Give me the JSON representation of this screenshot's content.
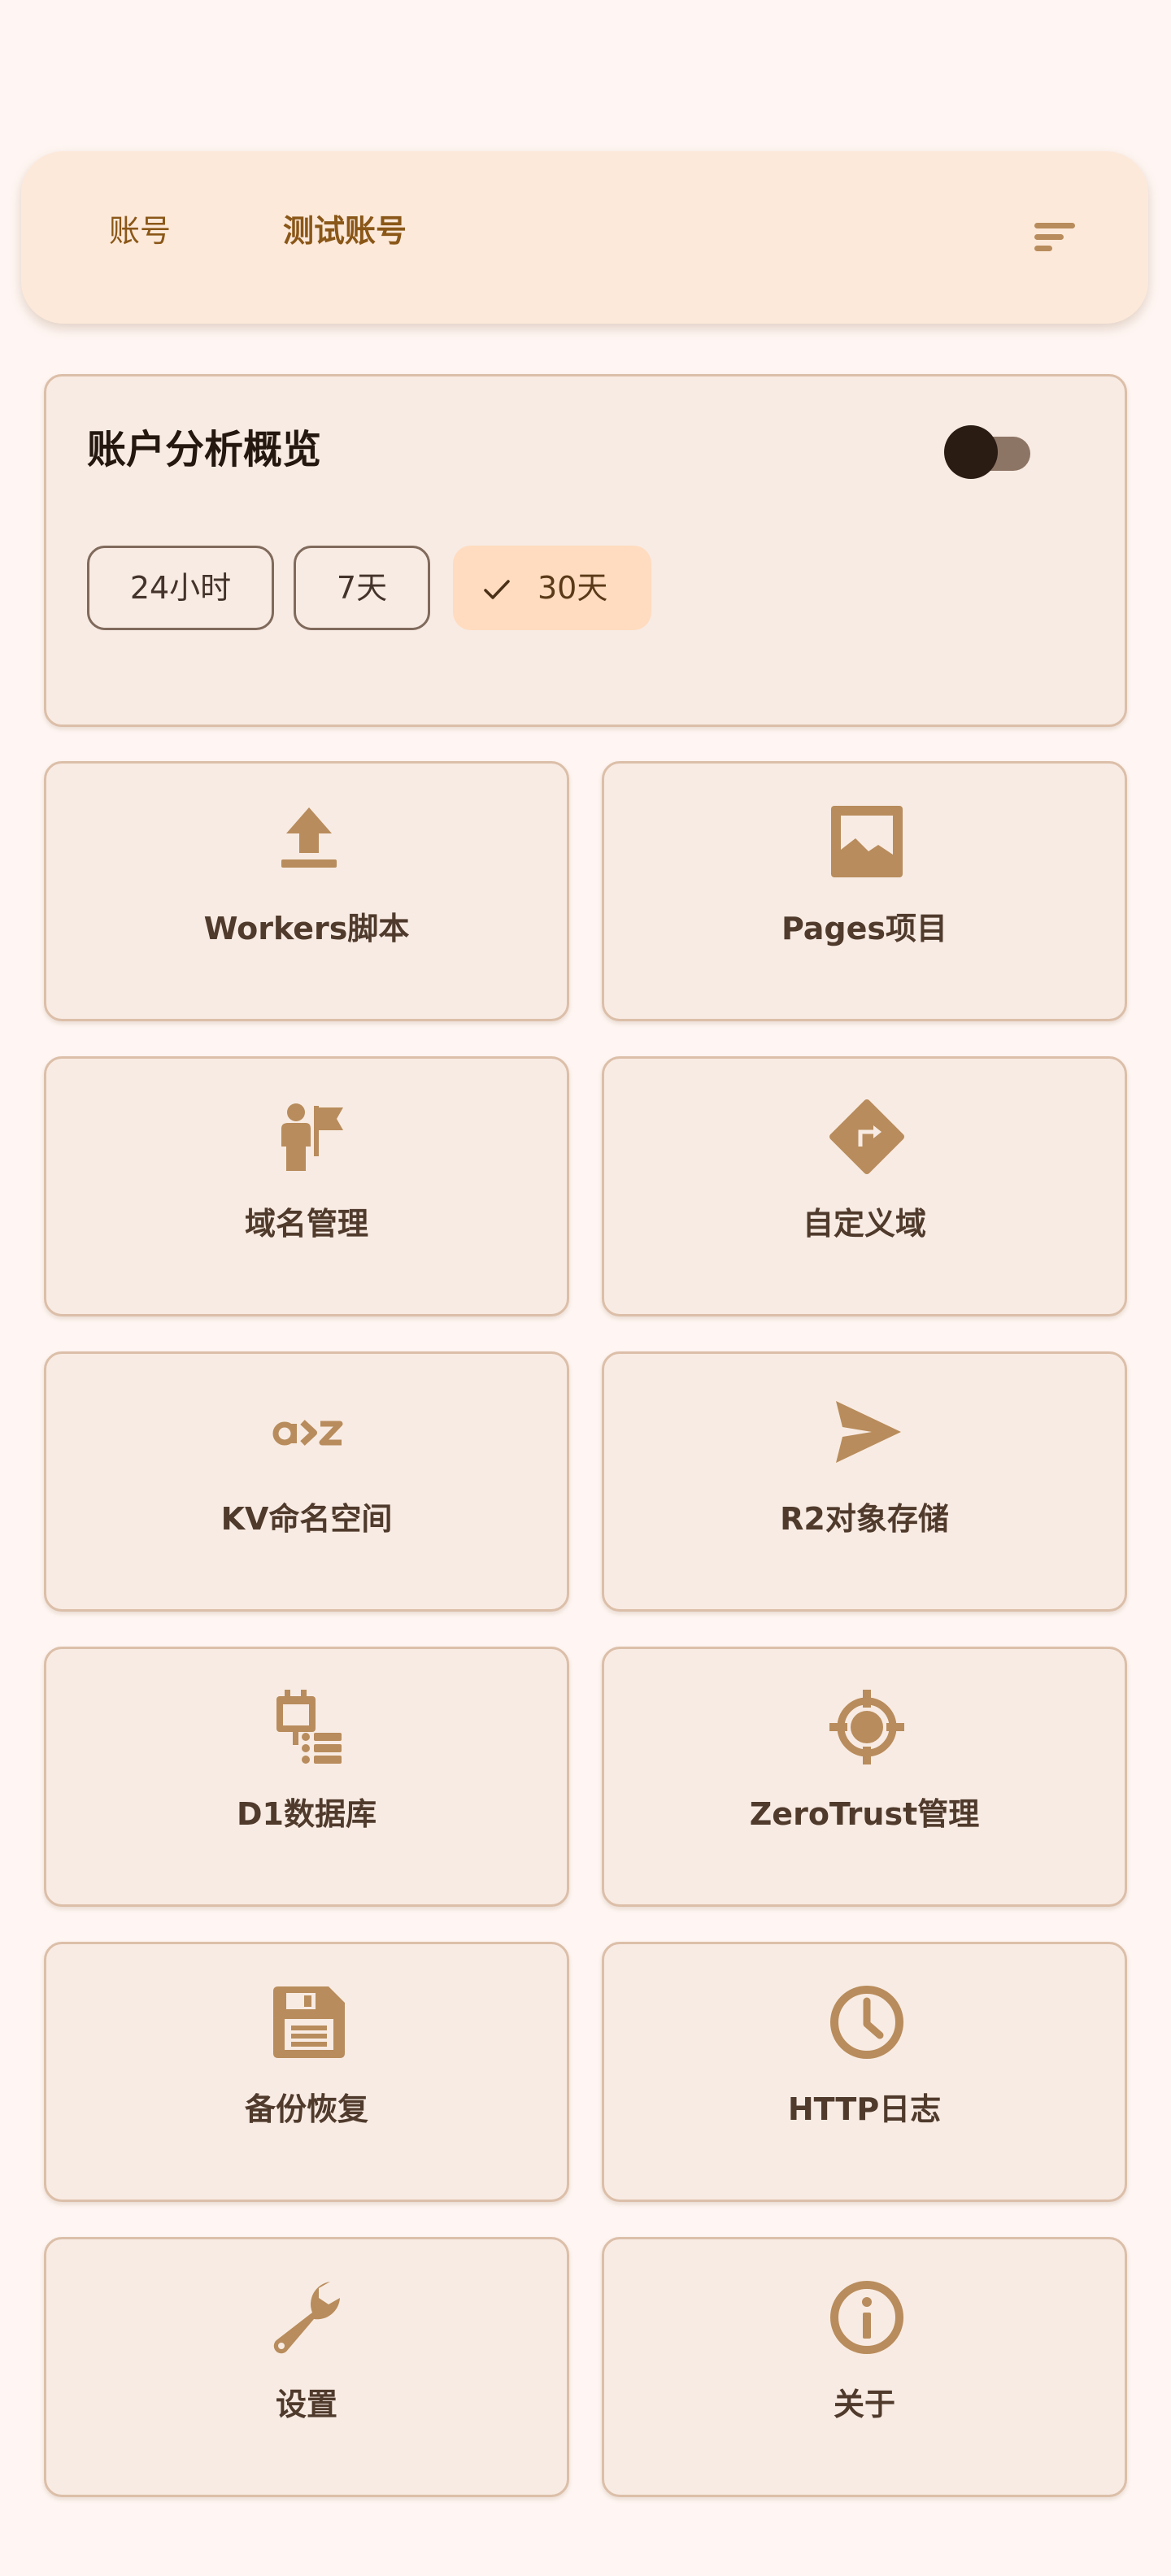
{
  "topbar": {
    "account_label": "账号",
    "account_name": "测试账号",
    "sort_icon": "sort-icon"
  },
  "overview": {
    "title": "账户分析概览",
    "toggle_on": false,
    "ranges": [
      {
        "label": "24小时",
        "selected": false
      },
      {
        "label": "7天",
        "selected": false
      },
      {
        "label": "30天",
        "selected": true
      }
    ]
  },
  "tiles": [
    {
      "label": "Workers脚本",
      "icon": "upload-icon"
    },
    {
      "label": "Pages项目",
      "icon": "image-icon"
    },
    {
      "label": "域名管理",
      "icon": "person-flag-icon"
    },
    {
      "label": "自定义域",
      "icon": "directions-icon"
    },
    {
      "label": "KV命名空间",
      "icon": "sort-by-alpha-icon"
    },
    {
      "label": "R2对象存储",
      "icon": "send-icon"
    },
    {
      "label": "D1数据库",
      "icon": "database-icon"
    },
    {
      "label": "ZeroTrust管理",
      "icon": "location-target-icon"
    },
    {
      "label": "备份恢复",
      "icon": "save-icon"
    },
    {
      "label": "HTTP日志",
      "icon": "clock-icon"
    },
    {
      "label": "设置",
      "icon": "wrench-icon"
    },
    {
      "label": "关于",
      "icon": "info-icon"
    }
  ],
  "colors": {
    "background": "#fff6f3",
    "topbar": "#fde9da",
    "card": "#f8ebe3",
    "card_border": "#dcbfa9",
    "icon": "#b88c5c",
    "accent_text": "#8a5718",
    "selected_chip": "#ffdcc0"
  }
}
